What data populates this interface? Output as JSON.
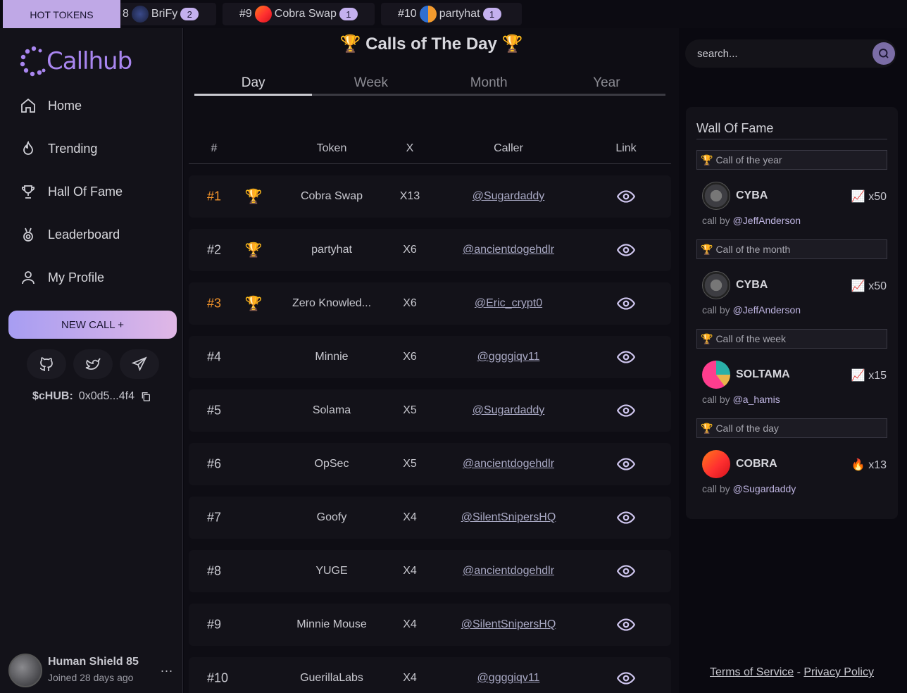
{
  "ticker": {
    "label": "HOT TOKENS",
    "items": [
      {
        "rank": "8",
        "name": "BriFy",
        "count": "2"
      },
      {
        "rank": "#9",
        "name": "Cobra Swap",
        "count": "1"
      },
      {
        "rank": "#10",
        "name": "partyhat",
        "count": "1"
      }
    ]
  },
  "sidebar": {
    "logo": "Callhub",
    "nav": [
      {
        "label": "Home",
        "icon": "home-icon"
      },
      {
        "label": "Trending",
        "icon": "flame-icon"
      },
      {
        "label": "Hall Of Fame",
        "icon": "trophy-icon"
      },
      {
        "label": "Leaderboard",
        "icon": "medal-icon"
      },
      {
        "label": "My Profile",
        "icon": "user-icon"
      }
    ],
    "new_call": "NEW CALL +",
    "contract_label": "$cHUB:",
    "contract_value": "0x0d5...4f4",
    "profile": {
      "name": "Human Shield 85",
      "joined": "Joined 28 days ago",
      "more": "..."
    }
  },
  "main": {
    "title": "🏆 Calls of The Day 🏆",
    "tabs": [
      "Day",
      "Week",
      "Month",
      "Year"
    ],
    "active_tab": "Day",
    "columns": [
      "#",
      "Token",
      "X",
      "Caller",
      "Link"
    ],
    "rows": [
      {
        "rank": "#1",
        "trophy": "🏆",
        "token": "Cobra Swap",
        "x": "X13",
        "caller": "@Sugardaddy"
      },
      {
        "rank": "#2",
        "trophy": "🏆",
        "token": "partyhat",
        "x": "X6",
        "caller": "@ancientdogehdlr"
      },
      {
        "rank": "#3",
        "trophy": "🏆",
        "token": "Zero Knowled...",
        "x": "X6",
        "caller": "@Eric_crypt0"
      },
      {
        "rank": "#4",
        "trophy": "",
        "token": "Minnie",
        "x": "X6",
        "caller": "@ggggiqv11"
      },
      {
        "rank": "#5",
        "trophy": "",
        "token": "Solama",
        "x": "X5",
        "caller": "@Sugardaddy"
      },
      {
        "rank": "#6",
        "trophy": "",
        "token": "OpSec",
        "x": "X5",
        "caller": "@ancientdogehdlr"
      },
      {
        "rank": "#7",
        "trophy": "",
        "token": "Goofy",
        "x": "X4",
        "caller": "@SilentSnipersHQ"
      },
      {
        "rank": "#8",
        "trophy": "",
        "token": "YUGE",
        "x": "X4",
        "caller": "@ancientdogehdlr"
      },
      {
        "rank": "#9",
        "trophy": "",
        "token": "Minnie Mouse",
        "x": "X4",
        "caller": "@SilentSnipersHQ"
      },
      {
        "rank": "#10",
        "trophy": "",
        "token": "GuerillaLabs",
        "x": "X4",
        "caller": "@ggggiqv11"
      }
    ]
  },
  "right": {
    "search_placeholder": "search...",
    "wall_title": "Wall Of Fame",
    "entries": [
      {
        "heading": "Call of the year",
        "token": "CYBA",
        "emoji": "📈",
        "mult": "x50",
        "by": "call by",
        "caller": "@JeffAnderson"
      },
      {
        "heading": "Call of the month",
        "token": "CYBA",
        "emoji": "📈",
        "mult": "x50",
        "by": "call by",
        "caller": "@JeffAnderson"
      },
      {
        "heading": "Call of the week",
        "token": "SOLTAMA",
        "emoji": "📈",
        "mult": "x15",
        "by": "call by",
        "caller": "@a_hamis"
      },
      {
        "heading": "Call of the day",
        "token": "COBRA",
        "emoji": "🔥",
        "mult": "x13",
        "by": "call by",
        "caller": "@Sugardaddy"
      }
    ],
    "footer": {
      "terms": "Terms of Service",
      "sep": "-",
      "privacy": "Privacy Policy"
    }
  }
}
